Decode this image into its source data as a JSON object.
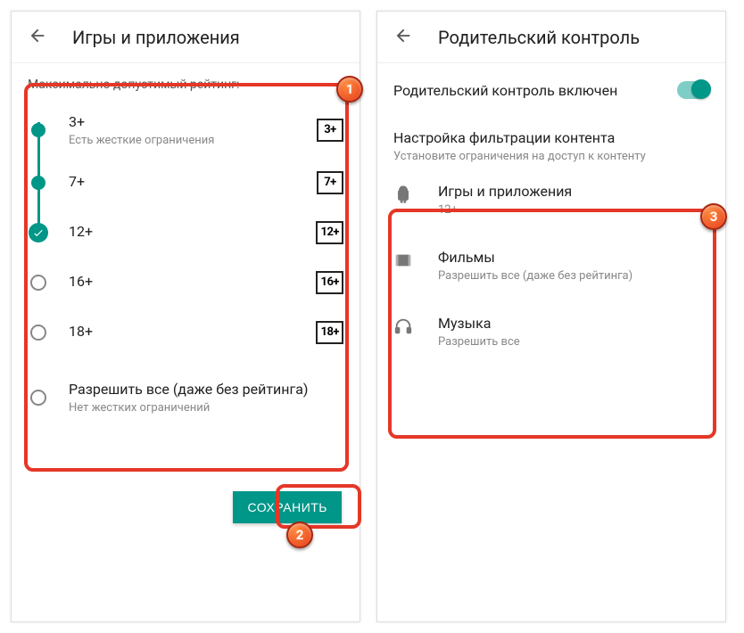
{
  "left": {
    "title": "Игры и приложения",
    "section": "Максимально допустимый рейтинг:",
    "options": [
      {
        "label": "3+",
        "sub": "Есть жесткие ограничения",
        "badge": "3+",
        "state": "filled"
      },
      {
        "label": "7+",
        "sub": "",
        "badge": "7+",
        "state": "filled"
      },
      {
        "label": "12+",
        "sub": "",
        "badge": "12+",
        "state": "selected"
      },
      {
        "label": "16+",
        "sub": "",
        "badge": "16+",
        "state": "empty"
      },
      {
        "label": "18+",
        "sub": "",
        "badge": "18+",
        "state": "empty"
      },
      {
        "label": "Разрешить все (даже без рейтинга)",
        "sub": "Нет жестких ограничений",
        "badge": "",
        "state": "empty"
      }
    ],
    "save": "СОХРАНИТЬ"
  },
  "right": {
    "title": "Родительский контроль",
    "switchLabel": "Родительский контроль включен",
    "filterTitle": "Настройка фильтрации контента",
    "filterSub": "Установите ограничения на доступ к контенту",
    "cats": [
      {
        "icon": "android",
        "title": "Игры и приложения",
        "sub": "12+"
      },
      {
        "icon": "film",
        "title": "Фильмы",
        "sub": "Разрешить все (даже без рейтинга)"
      },
      {
        "icon": "head",
        "title": "Музыка",
        "sub": "Разрешить все"
      }
    ]
  },
  "markers": {
    "a": "1",
    "b": "2",
    "c": "3"
  }
}
